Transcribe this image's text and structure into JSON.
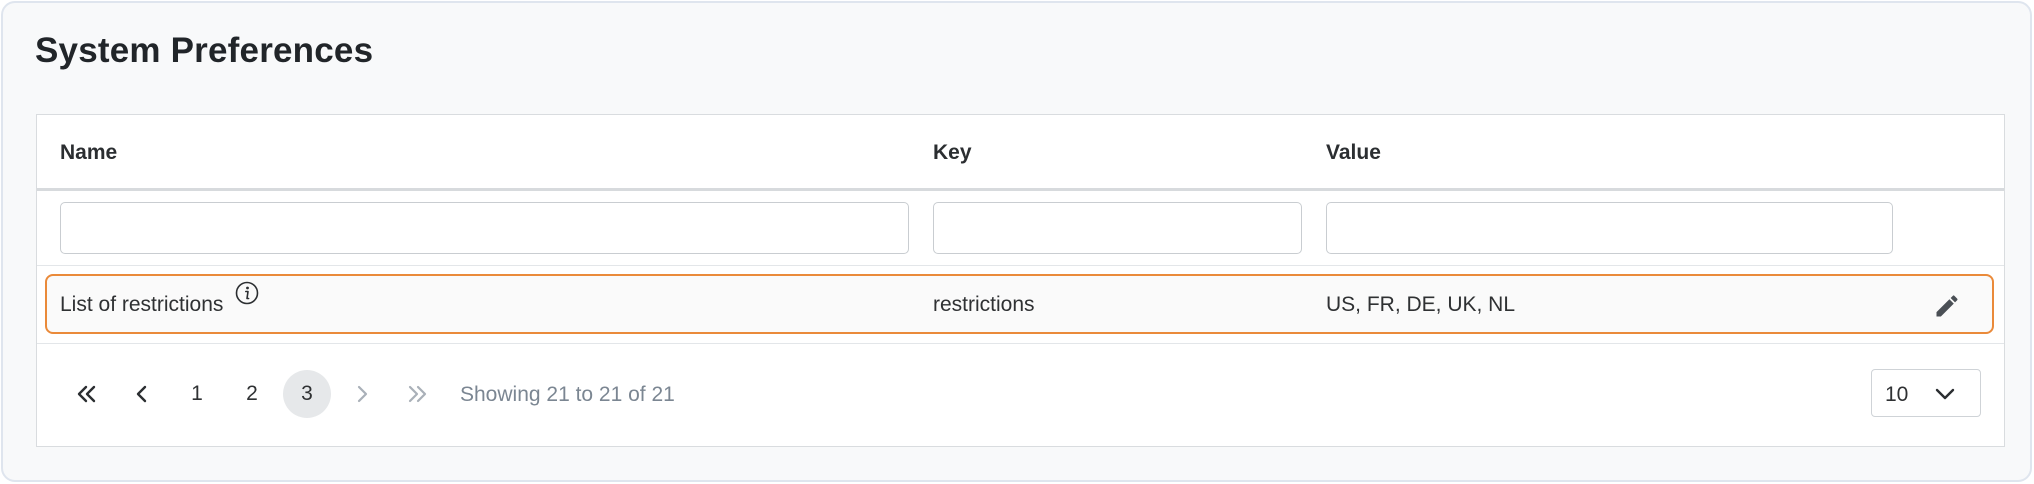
{
  "page": {
    "title": "System Preferences"
  },
  "table": {
    "columns": [
      "Name",
      "Key",
      "Value"
    ],
    "filters": {
      "name": "",
      "key": "",
      "value": ""
    },
    "rows": [
      {
        "name": "List of restrictions",
        "key": "restrictions",
        "value": "US, FR, DE, UK, NL"
      }
    ],
    "highlight_color": "#ea8a3a"
  },
  "pagination": {
    "pages": [
      "1",
      "2",
      "3"
    ],
    "current_page": "3",
    "summary": "Showing 21 to 21 of 21",
    "page_size": "10"
  },
  "icons": {
    "info": "info-icon",
    "edit": "pencil-icon",
    "first": "double-chevron-left-icon",
    "prev": "chevron-left-icon",
    "next": "chevron-right-icon",
    "last": "double-chevron-right-icon",
    "dropdown": "chevron-down-icon"
  }
}
